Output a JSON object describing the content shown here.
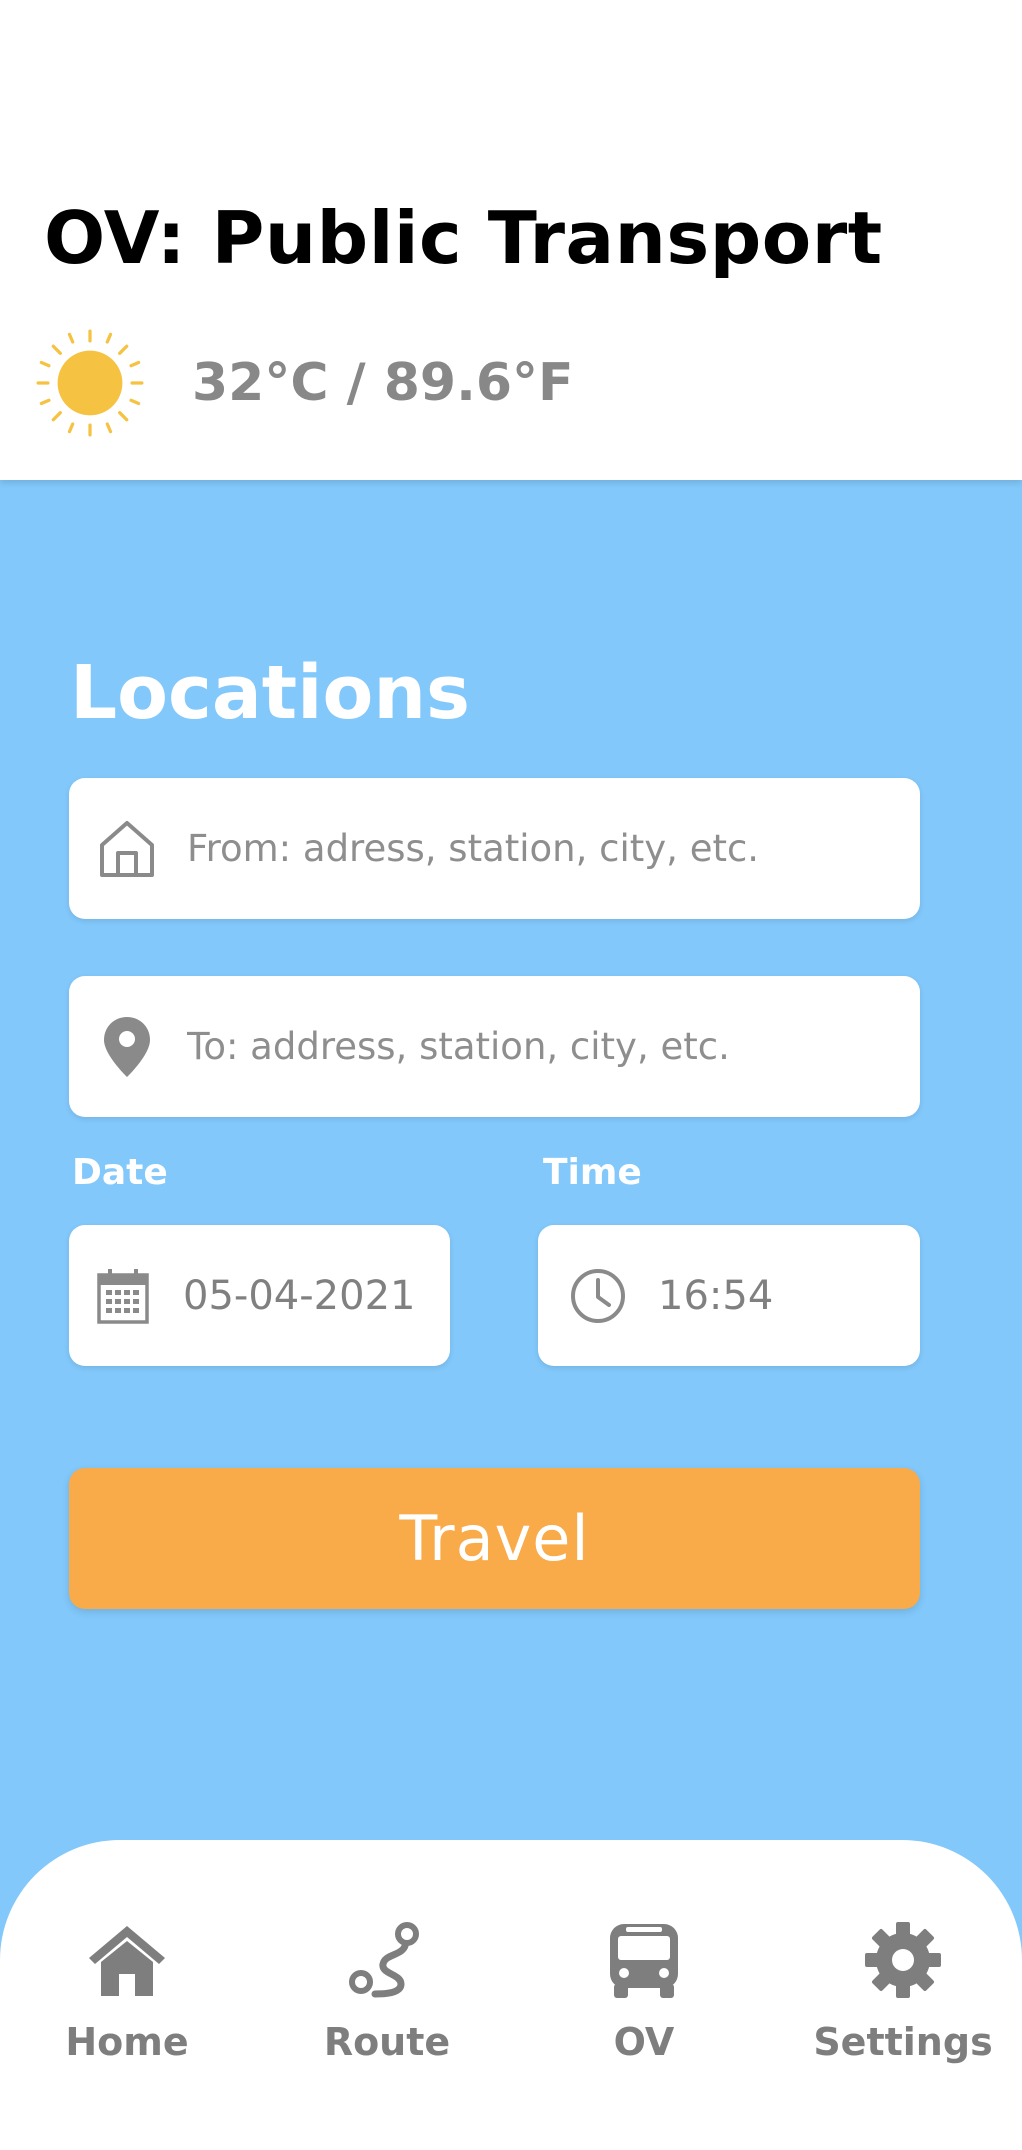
{
  "header": {
    "title": "OV: Public Transport",
    "weather": {
      "icon": "sun-icon",
      "temperature": "32°C / 89.6°F"
    }
  },
  "form": {
    "section_title": "Locations",
    "from": {
      "icon": "home-icon",
      "placeholder": "From: adress, station, city, etc."
    },
    "to": {
      "icon": "map-pin-icon",
      "placeholder": "To: address, station, city, etc."
    },
    "date": {
      "label": "Date",
      "icon": "calendar-icon",
      "value": "05-04-2021"
    },
    "time": {
      "label": "Time",
      "icon": "clock-icon",
      "value": "16:54"
    },
    "travel_button": "Travel"
  },
  "nav": {
    "items": [
      {
        "label": "Home",
        "icon": "home-icon"
      },
      {
        "label": "Route",
        "icon": "route-icon"
      },
      {
        "label": "OV",
        "icon": "bus-icon"
      },
      {
        "label": "Settings",
        "icon": "gear-icon"
      }
    ]
  },
  "colors": {
    "background": "#82c8fb",
    "accent": "#f8ab48",
    "sun": "#f5c242",
    "icon_gray": "#7e7e7e"
  }
}
